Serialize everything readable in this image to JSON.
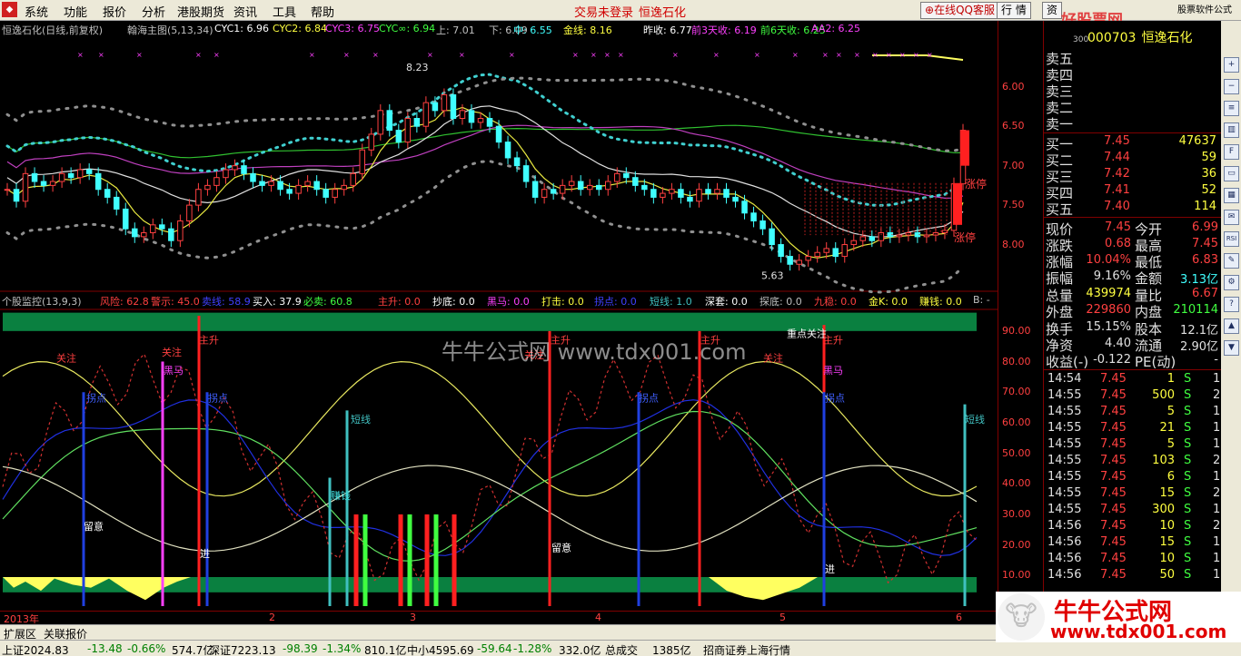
{
  "menu": {
    "logo_icon": "app-logo-icon",
    "items": [
      "系统",
      "功能",
      "报价",
      "分析",
      "港股期货",
      "资讯",
      "工具",
      "帮助"
    ],
    "trade_status": "交易未登录",
    "stock_name": "恒逸石化",
    "online_service": "在线QQ客服",
    "quote_btn": "行 情",
    "info_btn": "资",
    "watermark_site": "好股票网Goodgupiao.com",
    "watermark_tag": "股票软件公式"
  },
  "price_panel": {
    "title_items": [
      {
        "text": "恒逸石化(日线,前复权)",
        "color": "#c0c0c0"
      },
      {
        "text": "翰海主图(5,13,34)",
        "color": "#c0c0c0"
      },
      {
        "text": "CYC1: 6.96",
        "color": "#ffffff"
      },
      {
        "text": "CYC2: 6.84",
        "color": "#ffff40"
      },
      {
        "text": "CYC3: 6.75",
        "color": "#ff40ff"
      },
      {
        "text": "CYC∞: 6.94",
        "color": "#40ff40"
      },
      {
        "text": "上: 7.01",
        "color": "#c0c0c0"
      },
      {
        "text": "下: 6.09",
        "color": "#c0c0c0"
      },
      {
        "text": "中: 6.55",
        "color": "#40ffff"
      },
      {
        "text": "金线: 8.16",
        "color": "#ffff40"
      },
      {
        "text": "昨收: 6.77",
        "color": "#ffffff"
      },
      {
        "text": "前3天收: 6.19",
        "color": "#ff40ff"
      },
      {
        "text": "前6天收: 6.25",
        "color": "#40ff40"
      },
      {
        "text": "AA2: 6.25",
        "color": "#ff40ff"
      }
    ],
    "y_ticks": [
      "8.00",
      "7.50",
      "7.00",
      "6.50",
      "6.00"
    ],
    "high_label": "8.23",
    "low_label": "5.63",
    "limit_label_1": "涨停",
    "limit_label_2": "涨停"
  },
  "indicator_panel": {
    "title_items": [
      {
        "text": "个股监控(13,9,3)",
        "color": "#c0c0c0"
      },
      {
        "text": "风险: 62.8",
        "color": "#ff4040"
      },
      {
        "text": "警示: 45.0",
        "color": "#ff4040"
      },
      {
        "text": "卖线: 58.9",
        "color": "#4040ff"
      },
      {
        "text": "买入: 37.9",
        "color": "#ffffff"
      },
      {
        "text": "必卖: 60.8",
        "color": "#40ff40"
      },
      {
        "text": "主升: 0.0",
        "color": "#ff4040"
      },
      {
        "text": "抄底: 0.0",
        "color": "#ffffff"
      },
      {
        "text": "黑马: 0.0",
        "color": "#ff40ff"
      },
      {
        "text": "打击: 0.0",
        "color": "#ffff40"
      },
      {
        "text": "拐点: 0.0",
        "color": "#4040ff"
      },
      {
        "text": "短线: 1.0",
        "color": "#40c0c0"
      },
      {
        "text": "深套: 0.0",
        "color": "#ffffff"
      },
      {
        "text": "探底: 0.0",
        "color": "#c0c0c0"
      },
      {
        "text": "九稳: 0.0",
        "color": "#ff4040"
      },
      {
        "text": "金K: 0.0",
        "color": "#ffff40"
      },
      {
        "text": "赚钱: 0.0",
        "color": "#ffff40"
      },
      {
        "text": "B: -",
        "color": "#c0c0c0"
      }
    ],
    "y_ticks": [
      "90.00",
      "80.00",
      "70.00",
      "60.00",
      "50.00",
      "40.00",
      "30.00",
      "20.00",
      "10.00"
    ],
    "signal_labels": [
      "关注",
      "关注",
      "主升",
      "黑马",
      "拐点",
      "拐点",
      "短线",
      "赚钱",
      "留意",
      "进",
      "关注",
      "主升",
      "留意",
      "拐点",
      "主升",
      "关注",
      "重点关注",
      "主升",
      "黑马",
      "拐点",
      "进",
      "短线"
    ]
  },
  "x_axis": {
    "labels": [
      "2013年",
      "2",
      "3",
      "4",
      "5",
      "6"
    ]
  },
  "watermark": {
    "center": "牛牛公式网 www.tdx001.com",
    "logo_top": "牛牛公式网",
    "logo_bottom": "www.tdx001.com"
  },
  "quote": {
    "code": "000703",
    "name": "恒逸石化",
    "code_small": "300",
    "sell": [
      {
        "label": "卖五",
        "price": "",
        "vol": ""
      },
      {
        "label": "卖四",
        "price": "",
        "vol": ""
      },
      {
        "label": "卖三",
        "price": "",
        "vol": ""
      },
      {
        "label": "卖二",
        "price": "",
        "vol": ""
      },
      {
        "label": "卖一",
        "price": "",
        "vol": ""
      }
    ],
    "buy": [
      {
        "label": "买一",
        "price": "7.45",
        "vol": "47637"
      },
      {
        "label": "买二",
        "price": "7.44",
        "vol": "59"
      },
      {
        "label": "买三",
        "price": "7.42",
        "vol": "36"
      },
      {
        "label": "买四",
        "price": "7.41",
        "vol": "52"
      },
      {
        "label": "买五",
        "price": "7.40",
        "vol": "114"
      }
    ],
    "stats": [
      {
        "l1": "现价",
        "v1": "7.45",
        "c1": "#ff4040",
        "l2": "今开",
        "v2": "6.99",
        "c2": "#ff4040"
      },
      {
        "l1": "涨跌",
        "v1": "0.68",
        "c1": "#ff4040",
        "l2": "最高",
        "v2": "7.45",
        "c2": "#ff4040"
      },
      {
        "l1": "涨幅",
        "v1": "10.04%",
        "c1": "#ff4040",
        "l2": "最低",
        "v2": "6.83",
        "c2": "#ff4040"
      },
      {
        "l1": "振幅",
        "v1": "9.16%",
        "c1": "#e0e0e0",
        "l2": "金额",
        "v2": "3.13亿",
        "c2": "#40ffff"
      },
      {
        "l1": "总量",
        "v1": "439974",
        "c1": "#ffff40",
        "l2": "量比",
        "v2": "6.67",
        "c2": "#ff4040"
      },
      {
        "l1": "外盘",
        "v1": "229860",
        "c1": "#ff4040",
        "l2": "内盘",
        "v2": "210114",
        "c2": "#40ff40"
      },
      {
        "l1": "换手",
        "v1": "15.15%",
        "c1": "#e0e0e0",
        "l2": "股本",
        "v2": "12.1亿",
        "c2": "#e0e0e0"
      },
      {
        "l1": "净资",
        "v1": "4.40",
        "c1": "#e0e0e0",
        "l2": "流通",
        "v2": "2.90亿",
        "c2": "#e0e0e0"
      },
      {
        "l1": "收益(-)",
        "v1": "-0.122",
        "c1": "#e0e0e0",
        "l2": "PE(动)",
        "v2": "-",
        "c2": "#e0e0e0"
      }
    ],
    "ticks": [
      {
        "time": "14:54",
        "price": "7.45",
        "vol": "1",
        "bs": "S",
        "n": "1"
      },
      {
        "time": "14:55",
        "price": "7.45",
        "vol": "500",
        "bs": "S",
        "n": "2"
      },
      {
        "time": "14:55",
        "price": "7.45",
        "vol": "5",
        "bs": "S",
        "n": "1"
      },
      {
        "time": "14:55",
        "price": "7.45",
        "vol": "21",
        "bs": "S",
        "n": "1"
      },
      {
        "time": "14:55",
        "price": "7.45",
        "vol": "5",
        "bs": "S",
        "n": "1"
      },
      {
        "time": "14:55",
        "price": "7.45",
        "vol": "103",
        "bs": "S",
        "n": "2"
      },
      {
        "time": "14:55",
        "price": "7.45",
        "vol": "6",
        "bs": "S",
        "n": "1"
      },
      {
        "time": "14:55",
        "price": "7.45",
        "vol": "15",
        "bs": "S",
        "n": "2"
      },
      {
        "time": "14:55",
        "price": "7.45",
        "vol": "300",
        "bs": "S",
        "n": "1"
      },
      {
        "time": "14:56",
        "price": "7.45",
        "vol": "10",
        "bs": "S",
        "n": "2"
      },
      {
        "time": "14:56",
        "price": "7.45",
        "vol": "15",
        "bs": "S",
        "n": "1"
      },
      {
        "time": "14:56",
        "price": "7.45",
        "vol": "10",
        "bs": "S",
        "n": "1"
      },
      {
        "time": "14:56",
        "price": "7.45",
        "vol": "50",
        "bs": "S",
        "n": "1"
      }
    ]
  },
  "sidebar_icons": [
    "zoom-in-icon",
    "zoom-out-icon",
    "list-icon",
    "chart-icon",
    "f10-icon",
    "window-icon",
    "grid-icon",
    "news-icon",
    "rsi-icon",
    "tool-icon",
    "settings-icon",
    "help-icon",
    "up-icon",
    "down-icon"
  ],
  "sidebar_text": {
    "rsi": "RSI"
  },
  "tabs": [
    "扩展区",
    "关联报价"
  ],
  "status": [
    {
      "text": "上证2024.83",
      "color": "#000"
    },
    {
      "text": "-13.48",
      "color": "#008000"
    },
    {
      "text": "-0.66%",
      "color": "#008000"
    },
    {
      "text": "574.7亿",
      "color": "#000"
    },
    {
      "text": "深证7223.13",
      "color": "#000"
    },
    {
      "text": "-98.39",
      "color": "#008000"
    },
    {
      "text": "-1.34%",
      "color": "#008000"
    },
    {
      "text": "810.1亿",
      "color": "#000"
    },
    {
      "text": "中小4595.69",
      "color": "#000"
    },
    {
      "text": "-59.64",
      "color": "#008000"
    },
    {
      "text": "-1.28%",
      "color": "#008000"
    },
    {
      "text": "332.0亿",
      "color": "#000"
    },
    {
      "text": "总成交",
      "color": "#000"
    },
    {
      "text": "1385亿",
      "color": "#000"
    },
    {
      "text": "招商证券上海行情",
      "color": "#000"
    }
  ],
  "chart_data": [
    {
      "type": "candlestick",
      "title": "恒逸石化(日线,前复权)",
      "ylim": [
        5.5,
        8.4
      ],
      "y_ticks": [
        6.0,
        6.5,
        7.0,
        7.5,
        8.0
      ],
      "x_labels": [
        "2013年",
        "2",
        "3",
        "4",
        "5",
        "6"
      ],
      "annotations": [
        {
          "text": "8.23",
          "value": 8.23
        },
        {
          "text": "5.63",
          "value": 5.63
        }
      ],
      "close": [
        6.7,
        6.55,
        6.9,
        6.8,
        6.75,
        6.8,
        6.9,
        6.85,
        6.95,
        6.9,
        6.7,
        6.6,
        6.45,
        6.2,
        6.1,
        6.15,
        6.25,
        6.2,
        6.05,
        6.3,
        6.5,
        6.7,
        6.75,
        6.85,
        6.95,
        7.0,
        6.9,
        6.8,
        6.75,
        6.8,
        6.7,
        6.65,
        6.75,
        6.8,
        6.7,
        6.6,
        6.7,
        6.75,
        6.9,
        7.2,
        7.4,
        7.7,
        7.45,
        7.3,
        7.6,
        7.5,
        7.8,
        7.7,
        7.9,
        7.6,
        7.7,
        7.55,
        7.6,
        7.5,
        7.3,
        7.1,
        7.0,
        6.8,
        6.6,
        6.7,
        6.65,
        6.75,
        6.8,
        6.7,
        6.75,
        6.7,
        6.8,
        6.9,
        6.85,
        6.75,
        6.7,
        6.6,
        6.65,
        6.7,
        6.6,
        6.55,
        6.7,
        6.65,
        6.7,
        6.6,
        6.55,
        6.4,
        6.3,
        6.2,
        6.0,
        5.85,
        5.75,
        5.8,
        5.85,
        5.9,
        5.95,
        5.85,
        6.0,
        6.05,
        6.1,
        6.05,
        6.15,
        6.1,
        6.12,
        6.15,
        6.1,
        6.12,
        6.15,
        6.18,
        6.77,
        7.45
      ]
    },
    {
      "type": "line",
      "title": "个股监控(13,9,3)",
      "ylim": [
        0,
        95
      ],
      "y_ticks": [
        10,
        20,
        30,
        40,
        50,
        60,
        70,
        80,
        90
      ]
    }
  ]
}
